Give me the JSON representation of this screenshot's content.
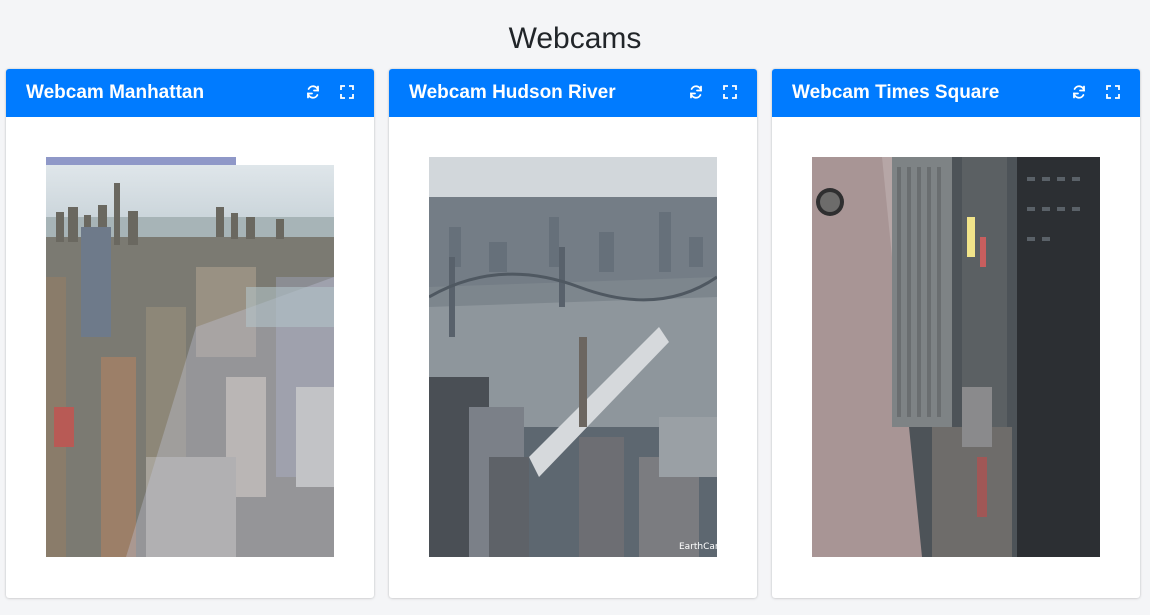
{
  "page": {
    "title": "Webcams"
  },
  "cards": [
    {
      "title": "Webcam Manhattan",
      "refresh_icon": "refresh-icon",
      "expand_icon": "expand-icon"
    },
    {
      "title": "Webcam Hudson River",
      "refresh_icon": "refresh-icon",
      "expand_icon": "expand-icon",
      "watermark": "EarthCam"
    },
    {
      "title": "Webcam Times Square",
      "refresh_icon": "refresh-icon",
      "expand_icon": "expand-icon"
    }
  ],
  "colors": {
    "header": "#007bff",
    "background": "#f4f5f7"
  }
}
